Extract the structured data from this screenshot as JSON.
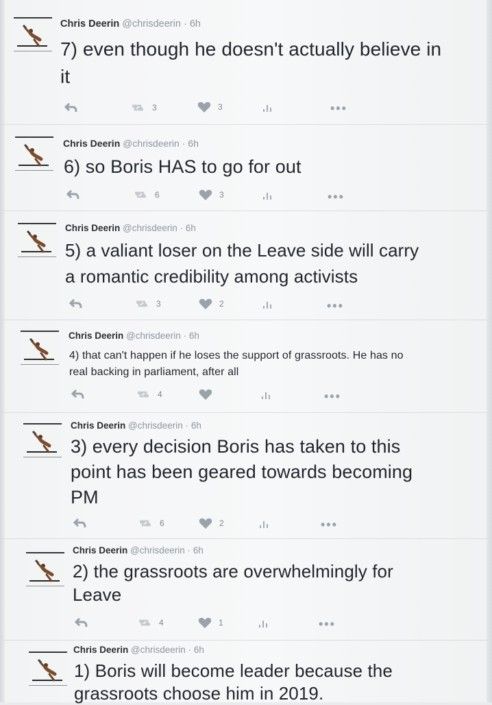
{
  "author": {
    "name": "Chris Deerin",
    "handle": "@chrisdeerin",
    "separator": "·",
    "time": "6h"
  },
  "tweets": [
    {
      "text": "7) even though he doesn't actually believe in\nit",
      "retweets": "3",
      "likes": "3"
    },
    {
      "text": "6) so Boris HAS to go for out",
      "retweets": "6",
      "likes": "3"
    },
    {
      "text": "5) a valiant loser on the Leave side will carry\na romantic credibility among activists",
      "retweets": "3",
      "likes": "2"
    },
    {
      "text": "4) that can't happen if he loses the support of grassroots. He has no\nreal backing in parliament, after all",
      "retweets": "4",
      "likes": ""
    },
    {
      "text": "3) every decision Boris has taken to this\npoint has been geared towards becoming\nPM",
      "retweets": "6",
      "likes": "2"
    },
    {
      "text": "2) the grassroots are overwhelmingly for\nLeave",
      "retweets": "4",
      "likes": "1"
    },
    {
      "text": "1) Boris will become leader because the\ngrassroots choose him in 2019.",
      "retweets": "",
      "likes": ""
    }
  ],
  "icons": {
    "reply": "reply-icon",
    "retweet": "retweet-icon",
    "like": "heart-icon",
    "analytics": "analytics-icon",
    "more": "more-icon"
  },
  "more_glyph": "•••"
}
